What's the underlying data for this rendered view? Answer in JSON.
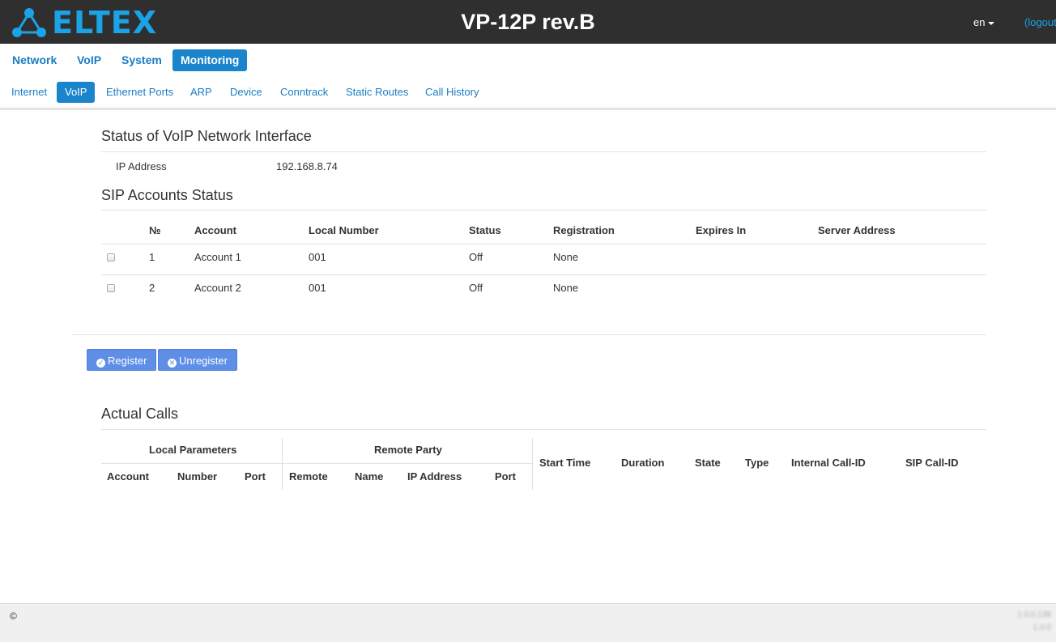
{
  "header": {
    "logo_text": "ELTEX",
    "device_title": "VP-12P rev.B",
    "lang": "en",
    "logout": "(logout)"
  },
  "main_nav": [
    "Network",
    "VoIP",
    "System",
    "Monitoring"
  ],
  "main_nav_active": "Monitoring",
  "sub_nav": [
    "Internet",
    "VoIP",
    "Ethernet Ports",
    "ARP",
    "Device",
    "Conntrack",
    "Static Routes",
    "Call History"
  ],
  "sub_nav_active": "VoIP",
  "voip_interface": {
    "title": "Status of VoIP Network Interface",
    "ip_label": "IP Address",
    "ip_value": "192.168.8.74"
  },
  "sip_accounts": {
    "title": "SIP Accounts Status",
    "columns": [
      "№",
      "Account",
      "Local Number",
      "Status",
      "Registration",
      "Expires In",
      "Server Address"
    ],
    "rows": [
      {
        "num": "1",
        "account": "Account 1",
        "local_number": "001",
        "status": "Off",
        "registration": "None",
        "expires": "",
        "server": ""
      },
      {
        "num": "2",
        "account": "Account 2",
        "local_number": "001",
        "status": "Off",
        "registration": "None",
        "expires": "",
        "server": ""
      }
    ]
  },
  "buttons": {
    "register": "Register",
    "unregister": "Unregister"
  },
  "actual_calls": {
    "title": "Actual Calls",
    "group_local": "Local Parameters",
    "group_remote": "Remote Party",
    "local_cols": [
      "Account",
      "Number",
      "Port"
    ],
    "remote_cols": [
      "Remote",
      "Name",
      "IP Address",
      "Port"
    ],
    "other_cols": [
      "Start Time",
      "Duration",
      "State",
      "Type",
      "Internal Call-ID",
      "SIP Call-ID"
    ]
  },
  "footer": {
    "copyright": "©",
    "version_1": "1.0.0.138",
    "version_2": "1.0.0"
  },
  "colors": {
    "header_bg": "#2f2f2f",
    "brand_blue": "#1aa3e6",
    "nav_active": "#1a84cc",
    "button": "#5e8ee6"
  }
}
